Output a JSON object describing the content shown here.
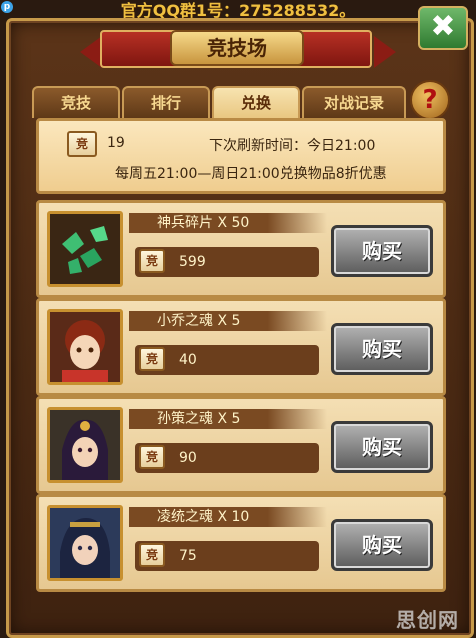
{
  "top_notice": "官方QQ群1号：275288532。",
  "corner_badge": "p",
  "title": "竞技场",
  "close_label": "✖",
  "help_label": "?",
  "tabs": [
    {
      "label": "竞技",
      "active": false
    },
    {
      "label": "排行",
      "active": false
    },
    {
      "label": "兑换",
      "active": true
    },
    {
      "label": "对战记录",
      "active": false
    }
  ],
  "info": {
    "currency_icon": "竞",
    "currency_amount": "19",
    "refresh_text": "下次刷新时间：今日21:00",
    "discount_text": "每周五21:00—周日21:00兑换物品8折优惠"
  },
  "items": [
    {
      "name": "神兵碎片 X 50",
      "price": "599",
      "icon": "jade-shards-icon",
      "price_icon": "竞",
      "buy_label": "购买"
    },
    {
      "name": "小乔之魂 X 5",
      "price": "40",
      "icon": "xiaoqiao-portrait",
      "price_icon": "竞",
      "buy_label": "购买"
    },
    {
      "name": "孙策之魂 X 5",
      "price": "90",
      "icon": "sunce-portrait",
      "price_icon": "竞",
      "buy_label": "购买"
    },
    {
      "name": "凌统之魂 X 10",
      "price": "75",
      "icon": "lingtong-portrait",
      "price_icon": "竞",
      "buy_label": "购买"
    }
  ],
  "watermark": "思创网"
}
